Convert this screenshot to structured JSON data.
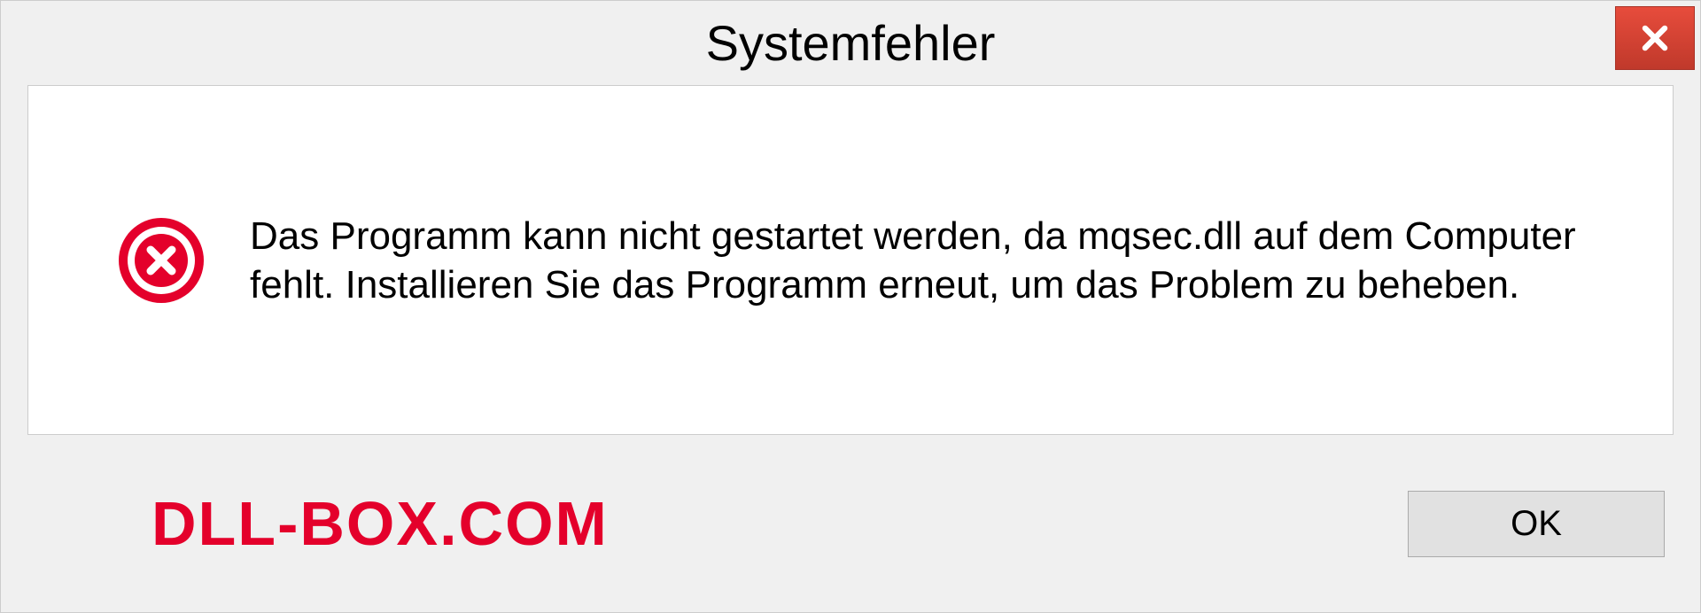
{
  "dialog": {
    "title": "Systemfehler",
    "message": "Das Programm kann nicht gestartet werden, da mqsec.dll auf dem Computer fehlt. Installieren Sie das Programm erneut, um das Problem zu beheben.",
    "ok_label": "OK",
    "watermark": "DLL-BOX.COM"
  }
}
